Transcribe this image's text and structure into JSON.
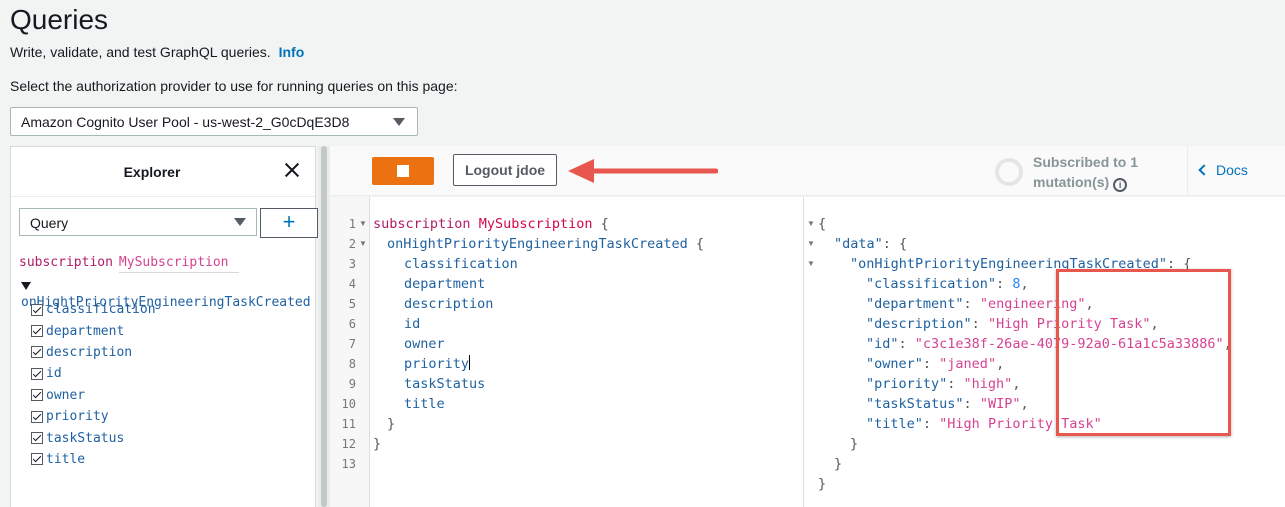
{
  "page": {
    "title": "Queries",
    "subtitle": "Write, validate, and test GraphQL queries.",
    "info_link": "Info",
    "auth_label": "Select the authorization provider to use for running queries on this page:",
    "auth_selected": "Amazon Cognito User Pool - us-west-2_G0cDqE3D8"
  },
  "explorer": {
    "title": "Explorer",
    "operation_type": "Query",
    "add_label": "+",
    "op_keyword": "subscription",
    "op_name": "MySubscription",
    "root_field": "onHightPriorityEngineeringTaskCreated",
    "fields": [
      "classification",
      "department",
      "description",
      "id",
      "owner",
      "priority",
      "taskStatus",
      "title"
    ]
  },
  "toolbar": {
    "logout_label": "Logout jdoe",
    "subscribed_line1": "Subscribed to 1",
    "subscribed_line2": "mutation(s)",
    "docs_label": "Docs",
    "accent_color": "#ec7211"
  },
  "editor": {
    "line_numbers": [
      "1",
      "2",
      "3",
      "4",
      "5",
      "6",
      "7",
      "8",
      "9",
      "10",
      "11",
      "12",
      "13"
    ],
    "line1": {
      "kw": "subscription",
      "name": "MySubscription",
      "brace": " {"
    },
    "line2": {
      "field": "onHightPriorityEngineeringTaskCreated",
      "brace": " {"
    },
    "fields": [
      "classification",
      "department",
      "description",
      "id",
      "owner",
      "priority",
      "taskStatus",
      "title"
    ],
    "close_inner": "}",
    "close_outer": "}"
  },
  "result": {
    "open": "{",
    "data_key": "\"data\"",
    "root_key": "\"onHightPriorityEngineeringTaskCreated\"",
    "entries": [
      {
        "key": "\"classification\"",
        "value": "8",
        "type": "num",
        "comma": ","
      },
      {
        "key": "\"department\"",
        "value": "\"engineering\"",
        "type": "str",
        "comma": ","
      },
      {
        "key": "\"description\"",
        "value": "\"High Priority Task\"",
        "type": "str",
        "comma": ","
      },
      {
        "key": "\"id\"",
        "value": "\"c3c1e38f-26ae-4079-92a0-61a1c5a33886\"",
        "type": "str",
        "comma": ","
      },
      {
        "key": "\"owner\"",
        "value": "\"janed\"",
        "type": "str",
        "comma": ","
      },
      {
        "key": "\"priority\"",
        "value": "\"high\"",
        "type": "str",
        "comma": ","
      },
      {
        "key": "\"taskStatus\"",
        "value": "\"WIP\"",
        "type": "str",
        "comma": ","
      },
      {
        "key": "\"title\"",
        "value": "\"High Priority Task\"",
        "type": "str",
        "comma": ""
      }
    ],
    "close": "}"
  }
}
